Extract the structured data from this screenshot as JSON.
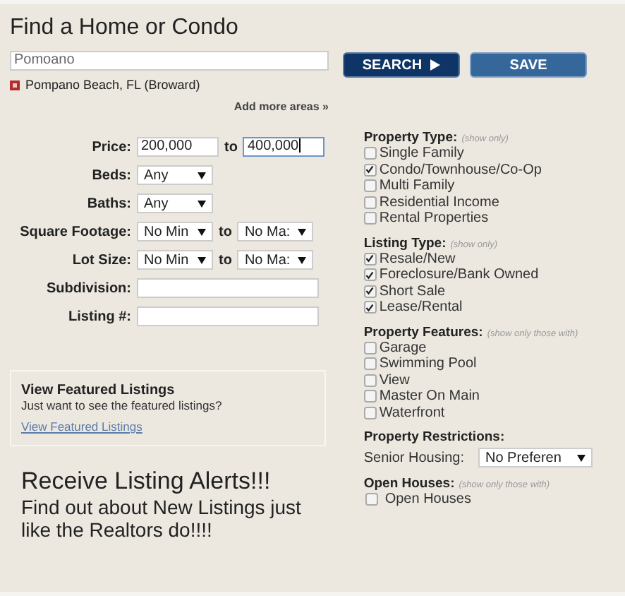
{
  "title": "Find a Home  or Condo",
  "location_field": {
    "value": "Pomoano"
  },
  "selected_areas": [
    {
      "label": "Pompano Beach, FL (Broward)"
    }
  ],
  "add_more_link": "Add more areas »",
  "buttons": [
    {
      "label": "SEARCH",
      "kind": "primary"
    },
    {
      "label": "SAVE",
      "kind": "secondary"
    }
  ],
  "criteria": [
    {
      "label": "Price:",
      "kind": "range-input",
      "from": "200,000",
      "joiner": "to",
      "to": "400,000",
      "to_focused": true
    },
    {
      "label": "Beds:",
      "kind": "select",
      "value": "Any"
    },
    {
      "label": "Baths:",
      "kind": "select",
      "value": "Any"
    },
    {
      "label": "Square Footage:",
      "kind": "range-select",
      "from": "No Min",
      "joiner": "to",
      "to": "No Ma:"
    },
    {
      "label": "Lot Size:",
      "kind": "range-select",
      "from": "No Min",
      "joiner": "to",
      "to": "No Ma:"
    },
    {
      "label": "Subdivision:",
      "kind": "text-input"
    },
    {
      "label": "Listing #:",
      "kind": "text-input"
    }
  ],
  "featured": {
    "title": "View Featured Listings",
    "text": "Just want to see the featured listings?",
    "link": "View Featured Listings"
  },
  "alerts": {
    "headline": "Receive Listing Alerts!!!",
    "body": "Find out about New Listings just like the Realtors do!!!!"
  },
  "filter_groups": [
    {
      "kind": "checkboxes",
      "heading": "Property Type:",
      "note": "(show only)",
      "options": [
        {
          "label": "Single Family",
          "checked": false
        },
        {
          "label": "Condo/Townhouse/Co-Op",
          "checked": true
        },
        {
          "label": "Multi Family",
          "checked": false
        },
        {
          "label": "Residential Income",
          "checked": false
        },
        {
          "label": "Rental Properties",
          "checked": false
        }
      ]
    },
    {
      "kind": "checkboxes",
      "heading": "Listing Type:",
      "note": "(show only)",
      "options": [
        {
          "label": "Resale/New",
          "checked": true
        },
        {
          "label": "Foreclosure/Bank Owned",
          "checked": true
        },
        {
          "label": "Short Sale",
          "checked": true
        },
        {
          "label": "Lease/Rental",
          "checked": true
        }
      ]
    },
    {
      "kind": "checkboxes",
      "heading": "Property Features:",
      "note": "(show only those with)",
      "options": [
        {
          "label": "Garage",
          "checked": false
        },
        {
          "label": "Swimming Pool",
          "checked": false
        },
        {
          "label": "View",
          "checked": false
        },
        {
          "label": "Master On Main",
          "checked": false
        },
        {
          "label": "Waterfront",
          "checked": false
        }
      ]
    },
    {
      "kind": "select",
      "heading": "Property Restrictions:",
      "field_label": "Senior Housing:",
      "value": "No Preferen"
    },
    {
      "kind": "checkboxes",
      "heading": "Open Houses:",
      "note": "(show only those with)",
      "options": [
        {
          "label": "Open Houses",
          "checked": false
        }
      ]
    }
  ]
}
